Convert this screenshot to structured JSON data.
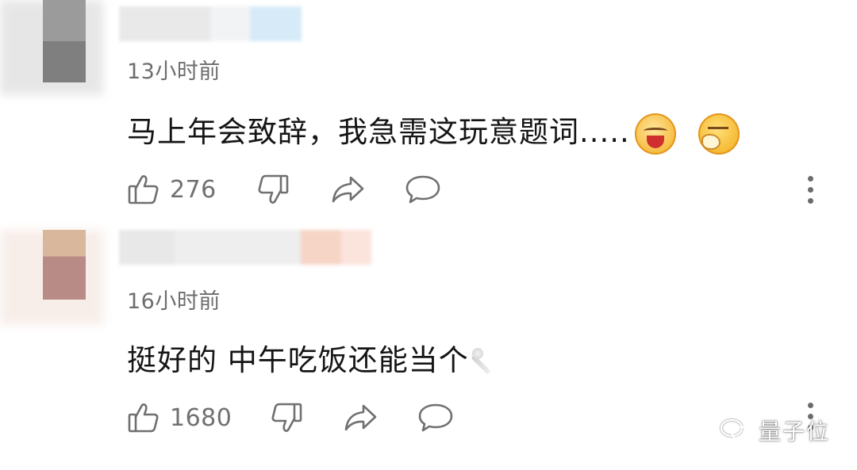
{
  "comments": [
    {
      "time": "13小时前",
      "text": "马上年会致辞，我急需这玩意题词.....",
      "emojis": [
        "laughing-emoji",
        "sneezing-emoji"
      ],
      "likes": "276"
    },
    {
      "time": "16小时前",
      "text": "挺好的 中午吃饭还能当个",
      "emojis": [
        "magic-wand-emoji"
      ],
      "likes": "1680"
    }
  ],
  "watermark": "量子位",
  "colors": {
    "background": "#ffffff",
    "text": "#151515",
    "meta": "#6d6d6d",
    "icon": "#707070"
  }
}
